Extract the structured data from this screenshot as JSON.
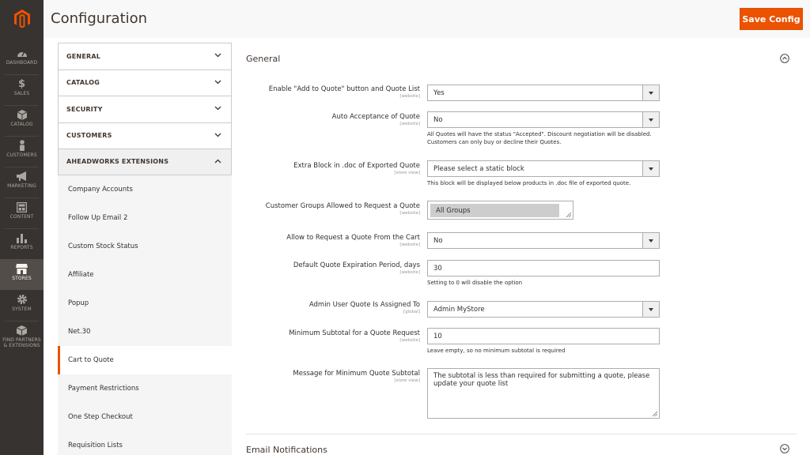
{
  "nav": {
    "items": [
      {
        "label": "DASHBOARD",
        "icon": "dashboard-icon"
      },
      {
        "label": "SALES",
        "icon": "dollar-icon"
      },
      {
        "label": "CATALOG",
        "icon": "cube-icon"
      },
      {
        "label": "CUSTOMERS",
        "icon": "person-icon"
      },
      {
        "label": "MARKETING",
        "icon": "megaphone-icon"
      },
      {
        "label": "CONTENT",
        "icon": "layout-icon"
      },
      {
        "label": "REPORTS",
        "icon": "bar-chart-icon"
      },
      {
        "label": "STORES",
        "icon": "store-icon"
      },
      {
        "label": "SYSTEM",
        "icon": "gear-icon"
      },
      {
        "label": "FIND PARTNERS",
        "label2": "& EXTENSIONS",
        "icon": "box-icon"
      }
    ]
  },
  "header": {
    "title": "Configuration",
    "save_label": "Save Config"
  },
  "tabs": {
    "groups": [
      "GENERAL",
      "CATALOG",
      "SECURITY",
      "CUSTOMERS",
      "AHEADWORKS EXTENSIONS"
    ],
    "subitems": [
      "Company Accounts",
      "Follow Up Email 2",
      "Custom Stock Status",
      "Affiliate",
      "Popup",
      "Net.30",
      "Cart to Quote",
      "Payment Restrictions",
      "One Step Checkout",
      "Requisition Lists"
    ],
    "active": "Cart to Quote"
  },
  "section": {
    "title": "General",
    "email_title": "Email Notifications"
  },
  "fields": {
    "enable": {
      "label": "Enable \"Add to Quote\" button and Quote List",
      "scope": "[website]",
      "value": "Yes"
    },
    "auto": {
      "label": "Auto Acceptance of Quote",
      "scope": "[website]",
      "value": "No",
      "note1": "All Quotes will have the status \"Accepted\". Discount negotiation will be disabled.",
      "note2": "Customers can only buy or decline their Quotes."
    },
    "extra": {
      "label": "Extra Block in .doc of Exported Quote",
      "scope": "[store view]",
      "value": "Please select a static block",
      "note": "This block will be displayed below products in .doc file of exported quote."
    },
    "groups": {
      "label": "Customer Groups Allowed to Request a Quote",
      "scope": "[website]",
      "value": "All Groups"
    },
    "cart": {
      "label": "Allow to Request a Quote From the Cart",
      "scope": "[website]",
      "value": "No"
    },
    "expiration": {
      "label": "Default Quote Expiration Period, days",
      "scope": "[website]",
      "value": "30",
      "note": "Setting to 0 will disable the option"
    },
    "admin": {
      "label": "Admin User Quote Is Assigned To",
      "scope": "[global]",
      "value": "Admin MyStore"
    },
    "minsub": {
      "label": "Minimum Subtotal for a Quote Request",
      "scope": "[website]",
      "value": "10",
      "note": "Leave empty, so no minimum subtotal is required"
    },
    "message": {
      "label": "Message for Minimum Quote Subtotal",
      "scope": "[store view]",
      "value": "The subtotal is less than required for submitting a quote, please update your quote list"
    }
  },
  "colors": {
    "accent": "#eb5202",
    "sidebar": "#373330"
  }
}
